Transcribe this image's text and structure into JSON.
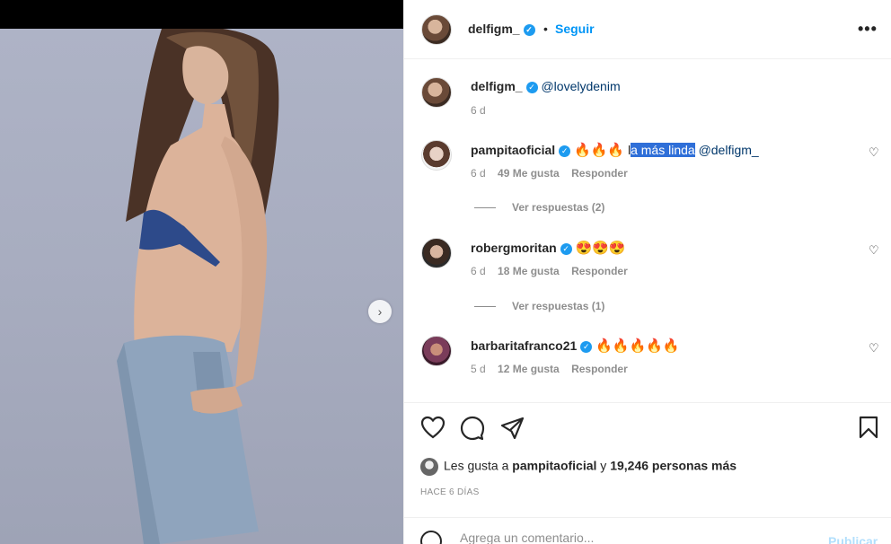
{
  "post": {
    "author": "delfigm_",
    "follow_label": "Seguir",
    "separator": "•",
    "more_label": "•••"
  },
  "caption": {
    "user": "delfigm_",
    "text": "@lovelydenim",
    "time": "6 d"
  },
  "comments": [
    {
      "user": "pampitaoficial",
      "emojis": "🔥🔥🔥",
      "text_plain": "l",
      "text_highlight": "a más linda",
      "mention": "@delfigm_",
      "time": "6 d",
      "likes": "49 Me gusta",
      "reply": "Responder",
      "view_replies": "Ver respuestas (2)"
    },
    {
      "user": "robergmoritan",
      "emojis": "😍😍😍",
      "time": "6 d",
      "likes": "18 Me gusta",
      "reply": "Responder",
      "view_replies": "Ver respuestas (1)"
    },
    {
      "user": "barbaritafranco21",
      "emojis": "🔥🔥🔥🔥🔥",
      "time": "5 d",
      "likes": "12 Me gusta",
      "reply": "Responder"
    }
  ],
  "likes_summary": {
    "prefix": "Les gusta a ",
    "user": "pampitaoficial",
    "middle": " y ",
    "count": "19,246 personas más"
  },
  "time_ago": "HACE 6 DÍAS",
  "composer": {
    "placeholder": "Agrega un comentario...",
    "publish_label": "Publicar"
  },
  "icons": {
    "verified": "verified-badge-icon",
    "next": "chevron-right-icon"
  },
  "carousel": {
    "total": 4,
    "active": 1
  },
  "colors": {
    "accent": "#0095f6",
    "verified": "#1d9bf0",
    "highlight": "#2f6fd8"
  }
}
